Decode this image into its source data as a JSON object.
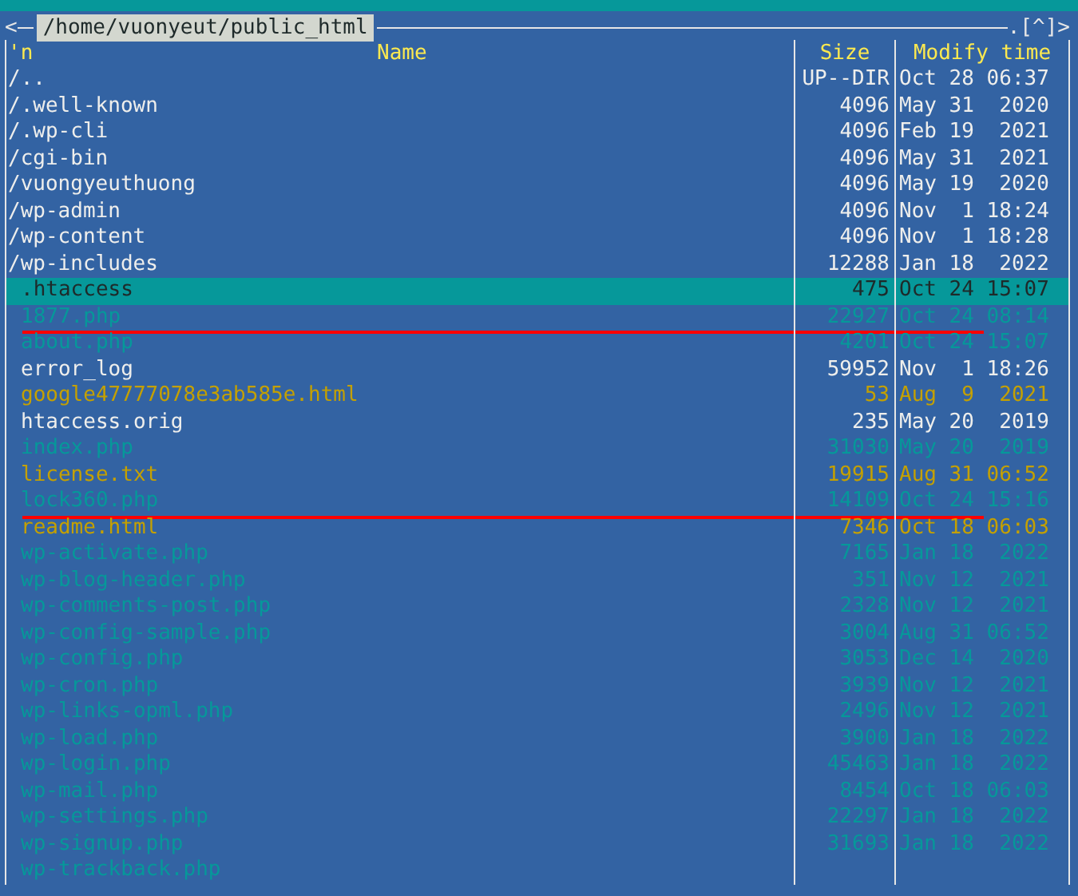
{
  "panel": {
    "left_mark": "<",
    "path": "/home/vuonyeut/public_html",
    "right_mark": ".[^]>",
    "columns": [
      "'n",
      "Name",
      "Size",
      "Modify time"
    ],
    "rows": [
      {
        "name": "/..",
        "size": "UP--DIR",
        "modified": "Oct 28 06:37",
        "kind": "dir",
        "selected": false,
        "underlined": false
      },
      {
        "name": "/.well-known",
        "size": "4096",
        "modified": "May 31  2020",
        "kind": "dir",
        "selected": false,
        "underlined": false
      },
      {
        "name": "/.wp-cli",
        "size": "4096",
        "modified": "Feb 19  2021",
        "kind": "dir",
        "selected": false,
        "underlined": false
      },
      {
        "name": "/cgi-bin",
        "size": "4096",
        "modified": "May 31  2021",
        "kind": "dir",
        "selected": false,
        "underlined": false
      },
      {
        "name": "/vuongyeuthuong",
        "size": "4096",
        "modified": "May 19  2020",
        "kind": "dir",
        "selected": false,
        "underlined": false
      },
      {
        "name": "/wp-admin",
        "size": "4096",
        "modified": "Nov  1 18:24",
        "kind": "dir",
        "selected": false,
        "underlined": false
      },
      {
        "name": "/wp-content",
        "size": "4096",
        "modified": "Nov  1 18:28",
        "kind": "dir",
        "selected": false,
        "underlined": false
      },
      {
        "name": "/wp-includes",
        "size": "12288",
        "modified": "Jan 18  2022",
        "kind": "dir",
        "selected": false,
        "underlined": false
      },
      {
        "name": ".htaccess",
        "size": "475",
        "modified": "Oct 24 15:07",
        "kind": "file",
        "selected": true,
        "underlined": false
      },
      {
        "name": "1877.php",
        "size": "22927",
        "modified": "Oct 24 08:14",
        "kind": "script",
        "selected": false,
        "underlined": true
      },
      {
        "name": "about.php",
        "size": "4201",
        "modified": "Oct 24 15:07",
        "kind": "script",
        "selected": false,
        "underlined": false
      },
      {
        "name": "error_log",
        "size": "59952",
        "modified": "Nov  1 18:26",
        "kind": "file",
        "selected": false,
        "underlined": false
      },
      {
        "name": "google47777078e3ab585e.html",
        "size": "53",
        "modified": "Aug  9  2021",
        "kind": "doc",
        "selected": false,
        "underlined": false
      },
      {
        "name": "htaccess.orig",
        "size": "235",
        "modified": "May 20  2019",
        "kind": "file",
        "selected": false,
        "underlined": false
      },
      {
        "name": "index.php",
        "size": "31030",
        "modified": "May 20  2019",
        "kind": "script",
        "selected": false,
        "underlined": false
      },
      {
        "name": "license.txt",
        "size": "19915",
        "modified": "Aug 31 06:52",
        "kind": "doc",
        "selected": false,
        "underlined": false
      },
      {
        "name": "lock360.php",
        "size": "14109",
        "modified": "Oct 24 15:16",
        "kind": "script",
        "selected": false,
        "underlined": true
      },
      {
        "name": "readme.html",
        "size": "7346",
        "modified": "Oct 18 06:03",
        "kind": "doc",
        "selected": false,
        "underlined": false
      },
      {
        "name": "wp-activate.php",
        "size": "7165",
        "modified": "Jan 18  2022",
        "kind": "script",
        "selected": false,
        "underlined": false
      },
      {
        "name": "wp-blog-header.php",
        "size": "351",
        "modified": "Nov 12  2021",
        "kind": "script",
        "selected": false,
        "underlined": false
      },
      {
        "name": "wp-comments-post.php",
        "size": "2328",
        "modified": "Nov 12  2021",
        "kind": "script",
        "selected": false,
        "underlined": false
      },
      {
        "name": "wp-config-sample.php",
        "size": "3004",
        "modified": "Aug 31 06:52",
        "kind": "script",
        "selected": false,
        "underlined": false
      },
      {
        "name": "wp-config.php",
        "size": "3053",
        "modified": "Dec 14  2020",
        "kind": "script",
        "selected": false,
        "underlined": false
      },
      {
        "name": "wp-cron.php",
        "size": "3939",
        "modified": "Nov 12  2021",
        "kind": "script",
        "selected": false,
        "underlined": false
      },
      {
        "name": "wp-links-opml.php",
        "size": "2496",
        "modified": "Nov 12  2021",
        "kind": "script",
        "selected": false,
        "underlined": false
      },
      {
        "name": "wp-load.php",
        "size": "3900",
        "modified": "Jan 18  2022",
        "kind": "script",
        "selected": false,
        "underlined": false
      },
      {
        "name": "wp-login.php",
        "size": "45463",
        "modified": "Jan 18  2022",
        "kind": "script",
        "selected": false,
        "underlined": false
      },
      {
        "name": "wp-mail.php",
        "size": "8454",
        "modified": "Oct 18 06:03",
        "kind": "script",
        "selected": false,
        "underlined": false
      },
      {
        "name": "wp-settings.php",
        "size": "22297",
        "modified": "Jan 18  2022",
        "kind": "script",
        "selected": false,
        "underlined": false
      },
      {
        "name": "wp-signup.php",
        "size": "31693",
        "modified": "Jan 18  2022",
        "kind": "script",
        "selected": false,
        "underlined": false
      },
      {
        "name": "wp-trackback.php",
        "kind": "script",
        "selected": false,
        "underlined": false
      }
    ]
  }
}
